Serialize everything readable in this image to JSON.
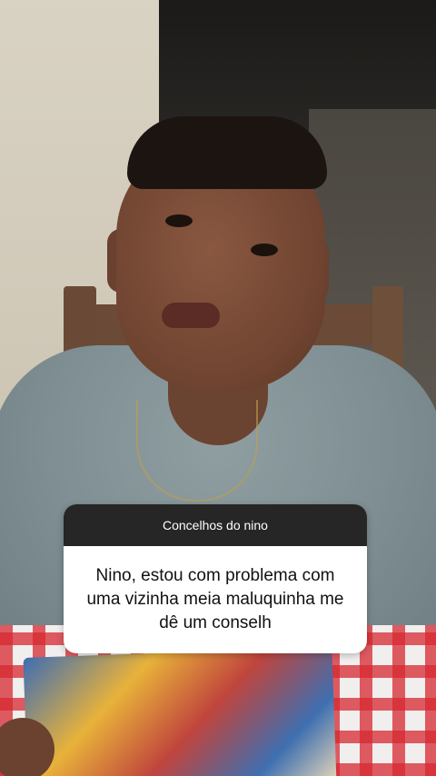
{
  "question_sticker": {
    "header": "Concelhos do nino",
    "question": "Nino, estou com problema com uma vizinha meia maluquinha me dê um conselh"
  },
  "colors": {
    "sticker_header_bg": "#262626",
    "sticker_body_bg": "#ffffff",
    "tablecloth_red": "#d62830"
  }
}
